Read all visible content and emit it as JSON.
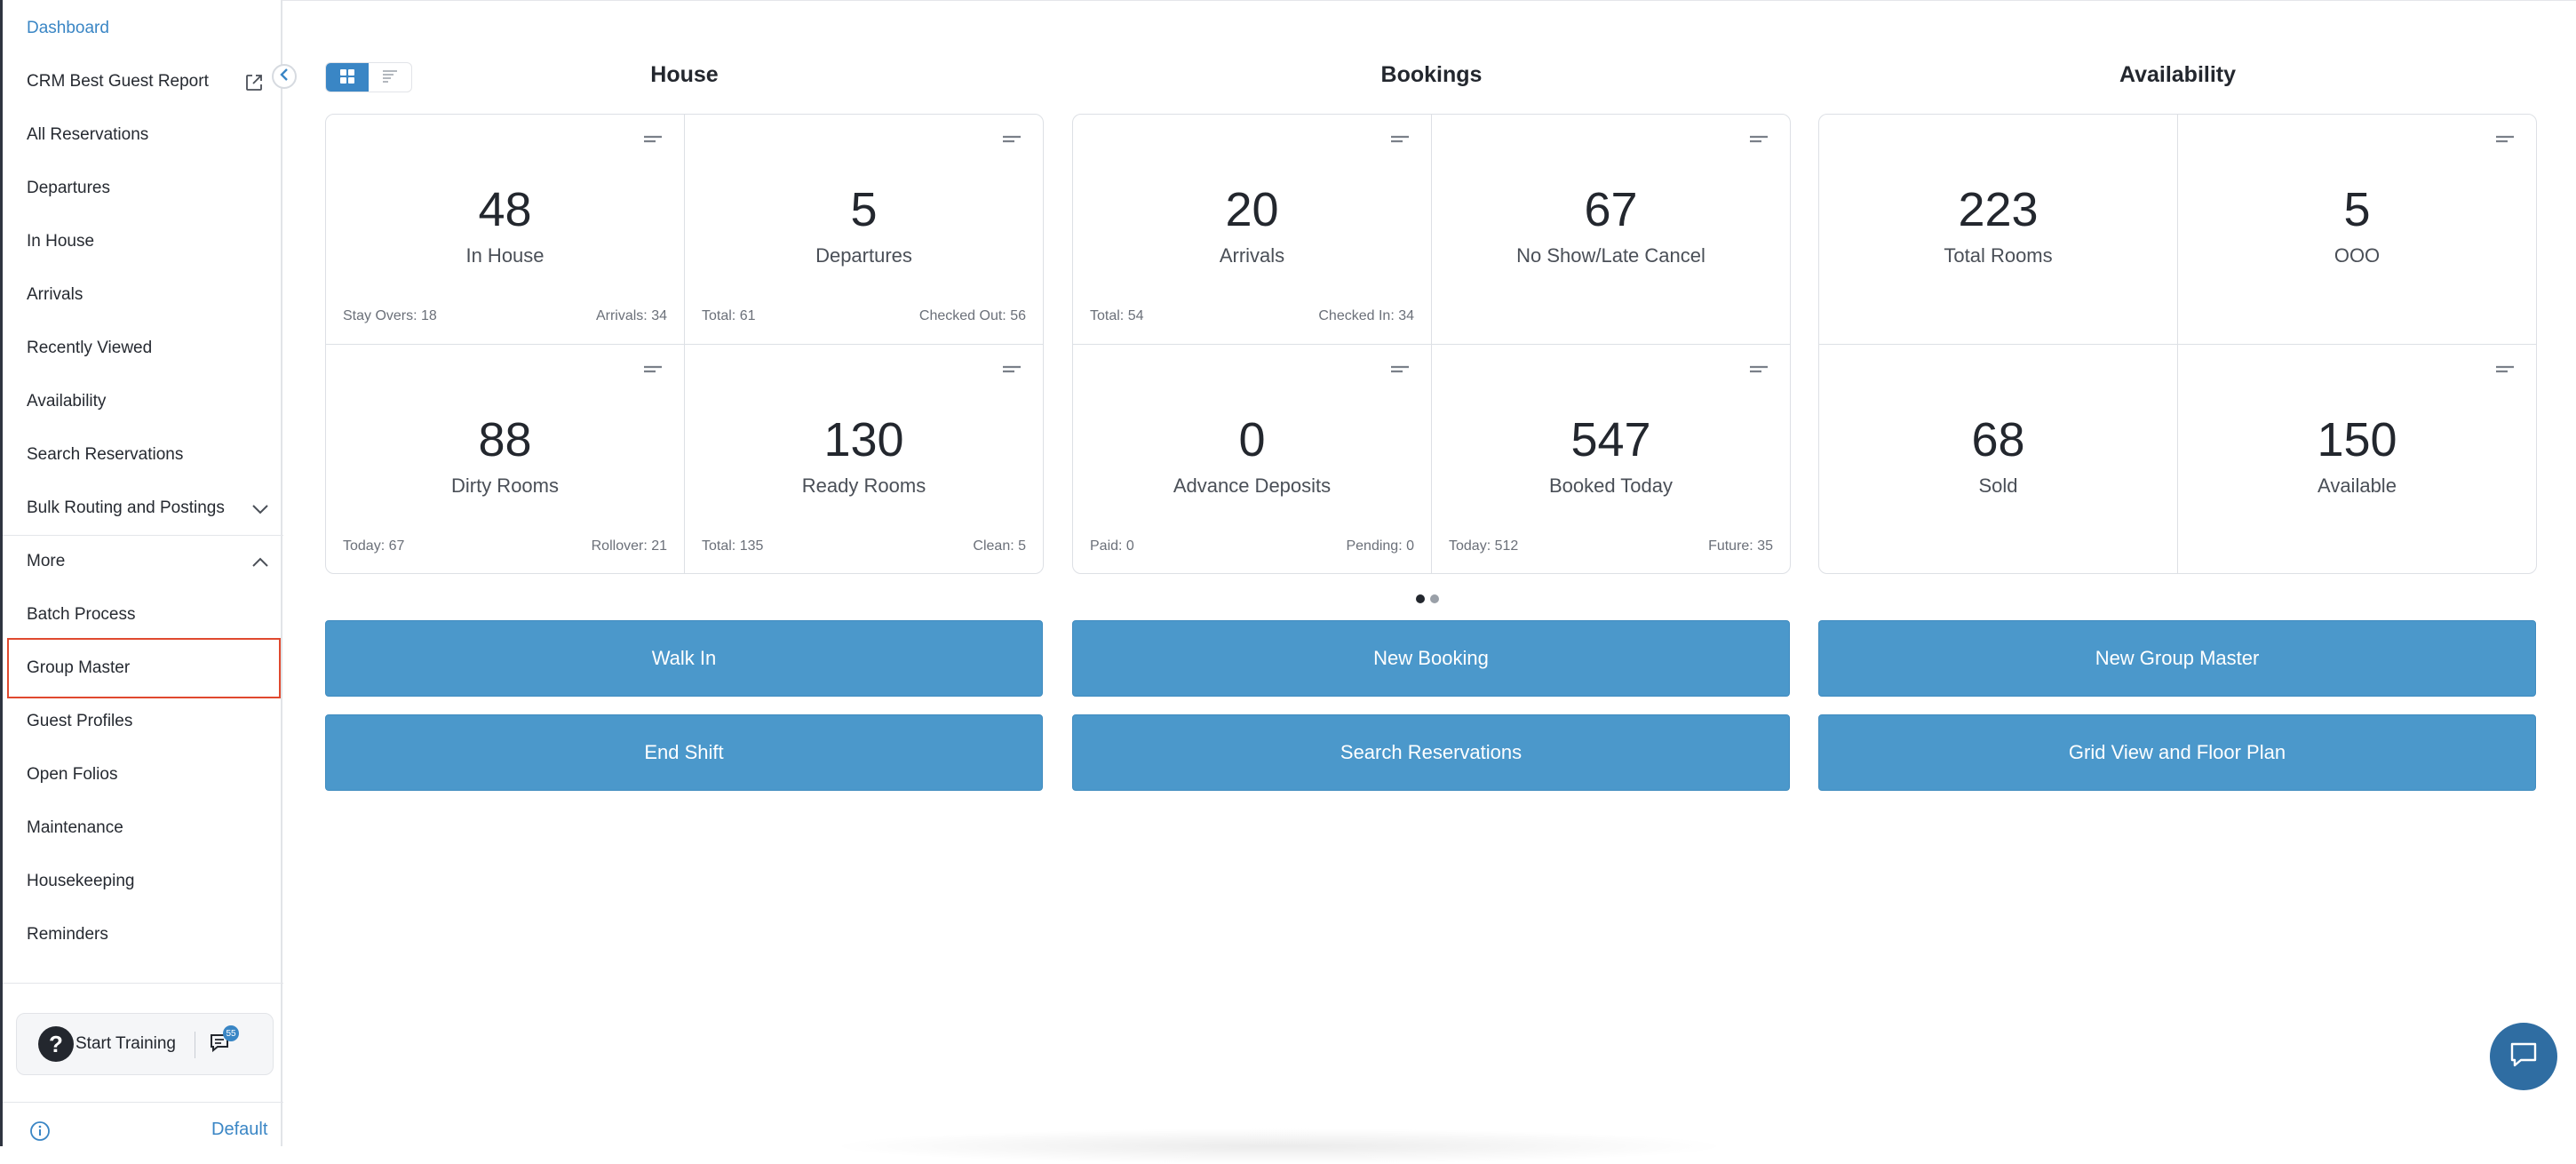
{
  "sidebar": {
    "items": [
      {
        "label": "Dashboard"
      },
      {
        "label": "CRM Best Guest Report"
      },
      {
        "label": "All Reservations"
      },
      {
        "label": "Departures"
      },
      {
        "label": "In House"
      },
      {
        "label": "Arrivals"
      },
      {
        "label": "Recently Viewed"
      },
      {
        "label": "Availability"
      },
      {
        "label": "Search Reservations"
      },
      {
        "label": "Bulk Routing and Postings"
      },
      {
        "label": "More"
      },
      {
        "label": "Batch Process"
      },
      {
        "label": "Group Master"
      },
      {
        "label": "Guest Profiles"
      },
      {
        "label": "Open Folios"
      },
      {
        "label": "Maintenance"
      },
      {
        "label": "Housekeeping"
      },
      {
        "label": "Reminders"
      }
    ],
    "active_item": "Dashboard",
    "training": {
      "label": "Start Training",
      "help_glyph": "?",
      "chat_badge": "55"
    },
    "footer": {
      "default_label": "Default"
    }
  },
  "sections": [
    {
      "title": "House"
    },
    {
      "title": "Bookings"
    },
    {
      "title": "Availability"
    }
  ],
  "tiles": {
    "house": [
      {
        "value": "48",
        "label": "In House",
        "left": "Stay Overs: 18",
        "right": "Arrivals: 34"
      },
      {
        "value": "5",
        "label": "Departures",
        "left": "Total: 61",
        "right": "Checked Out: 56"
      },
      {
        "value": "88",
        "label": "Dirty Rooms",
        "left": "Today: 67",
        "right": "Rollover: 21"
      },
      {
        "value": "130",
        "label": "Ready Rooms",
        "left": "Total: 135",
        "right": "Clean: 5"
      }
    ],
    "bookings": [
      {
        "value": "20",
        "label": "Arrivals",
        "left": "Total: 54",
        "right": "Checked In: 34"
      },
      {
        "value": "67",
        "label": "No Show/Late Cancel",
        "left": "",
        "right": ""
      },
      {
        "value": "0",
        "label": "Advance Deposits",
        "left": "Paid: 0",
        "right": "Pending: 0"
      },
      {
        "value": "547",
        "label": "Booked Today",
        "left": "Today: 512",
        "right": "Future: 35"
      }
    ],
    "availability": [
      {
        "value": "223",
        "label": "Total Rooms",
        "left": "",
        "right": ""
      },
      {
        "value": "5",
        "label": "OOO",
        "left": "",
        "right": ""
      },
      {
        "value": "68",
        "label": "Sold",
        "left": "",
        "right": ""
      },
      {
        "value": "150",
        "label": "Available",
        "left": "",
        "right": ""
      }
    ]
  },
  "pagination": {
    "pages": 2,
    "current": 1
  },
  "actions": [
    {
      "label": "Walk In"
    },
    {
      "label": "New Booking"
    },
    {
      "label": "New Group Master"
    },
    {
      "label": "End Shift"
    },
    {
      "label": "Search Reservations"
    },
    {
      "label": "Grid View and Floor Plan"
    }
  ],
  "colors": {
    "accent": "#3a86c5",
    "button": "#4b98cb",
    "highlight": "#e0492f"
  }
}
